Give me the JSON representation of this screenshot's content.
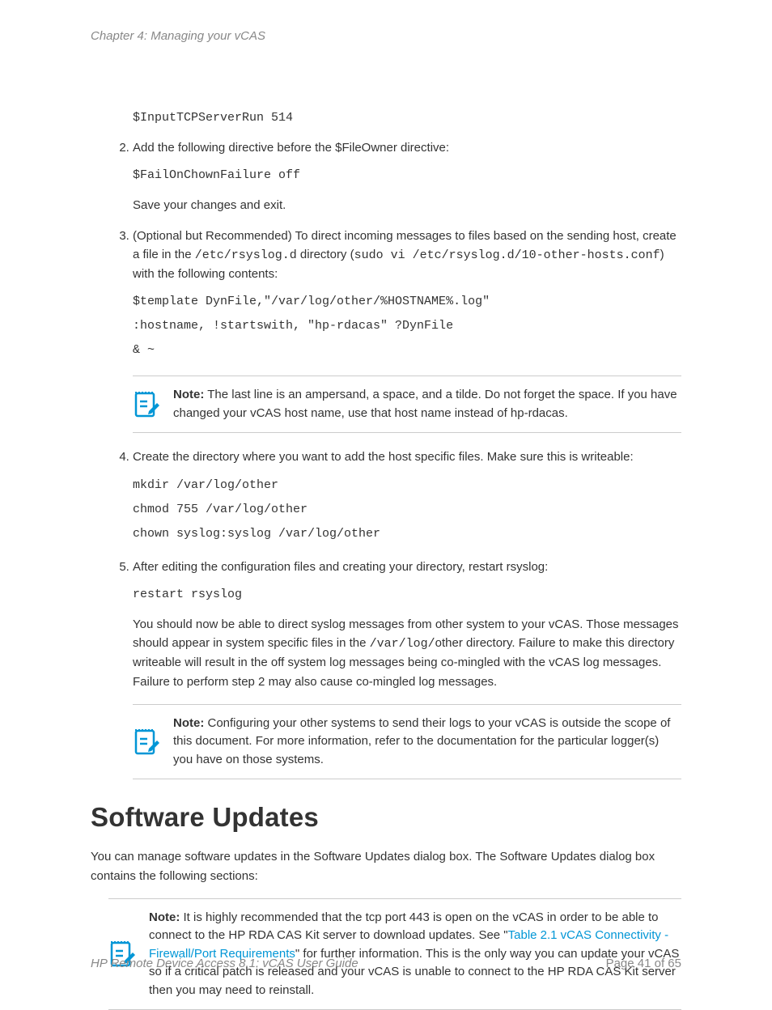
{
  "header": {
    "chapter": "Chapter 4: Managing your vCAS"
  },
  "steps": {
    "s1_code": "$InputTCPServerRun 514",
    "s2_intro": "Add the following directive before the $FileOwner directive:",
    "s2_code": "$FailOnChownFailure off",
    "s2_after": "Save your changes and exit.",
    "s3_intro_a": "(Optional but Recommended) To direct incoming messages to files based on the sending host, create a file in the ",
    "s3_path1": "/etc/rsyslog.d",
    "s3_intro_b": " directory (",
    "s3_cmd1": "sudo vi /etc/rsyslog.d/10-other-hosts.conf",
    "s3_intro_c": ") with the following contents:",
    "s3_code": "$template DynFile,\"/var/log/other/%HOSTNAME%.log\"\n:hostname, !startswith, \"hp-rdacas\" ?DynFile\n& ~",
    "s4_intro": "Create the directory where you want to add the host specific files. Make sure this is writeable:",
    "s4_code": "mkdir /var/log/other\nchmod 755 /var/log/other\nchown syslog:syslog /var/log/other",
    "s5_intro": "After editing the configuration files and creating your directory, restart rsyslog:",
    "s5_code": "restart rsyslog",
    "s5_after_a": "You should now be able to direct syslog messages from other system to your vCAS. Those messages should appear in system specific files in the ",
    "s5_path": "/var/log/",
    "s5_after_b": "other directory. Failure to make this directory writeable will result in the off system log messages being co-mingled with the vCAS log messages. Failure to perform step 2 may also cause co-mingled log messages."
  },
  "notes": {
    "n1_label": "Note:",
    "n1_text": " The last line is an ampersand, a space, and a tilde. Do not forget the space. If you have changed your vCAS host name, use that host name instead of hp-rdacas.",
    "n2_label": "Note:",
    "n2_text": " Configuring your other systems to send their logs to your vCAS is outside the scope of this document. For more information, refer to the documentation for the particular logger(s) you have on those systems.",
    "n3_label": "Note:",
    "n3_text_a": " It is highly recommended that the tcp port 443 is open on the vCAS in order to be able to connect to the HP RDA CAS Kit server to download updates. See \"",
    "n3_link": "Table 2.1 vCAS Connectivity - Firewall/Port Requirements",
    "n3_text_b": "\" for further information. This is the only way you can update your vCAS so if a critical patch is released and your vCAS is unable to connect to the HP RDA CAS Kit server then you may need to reinstall."
  },
  "section": {
    "heading": "Software Updates",
    "intro": "You can manage software updates in the Software Updates dialog box. The Software Updates dialog box contains the following sections:"
  },
  "footer": {
    "doc_title": "HP Remote Device Access 8.1: vCAS User Guide",
    "page": "Page 41 of 65"
  }
}
